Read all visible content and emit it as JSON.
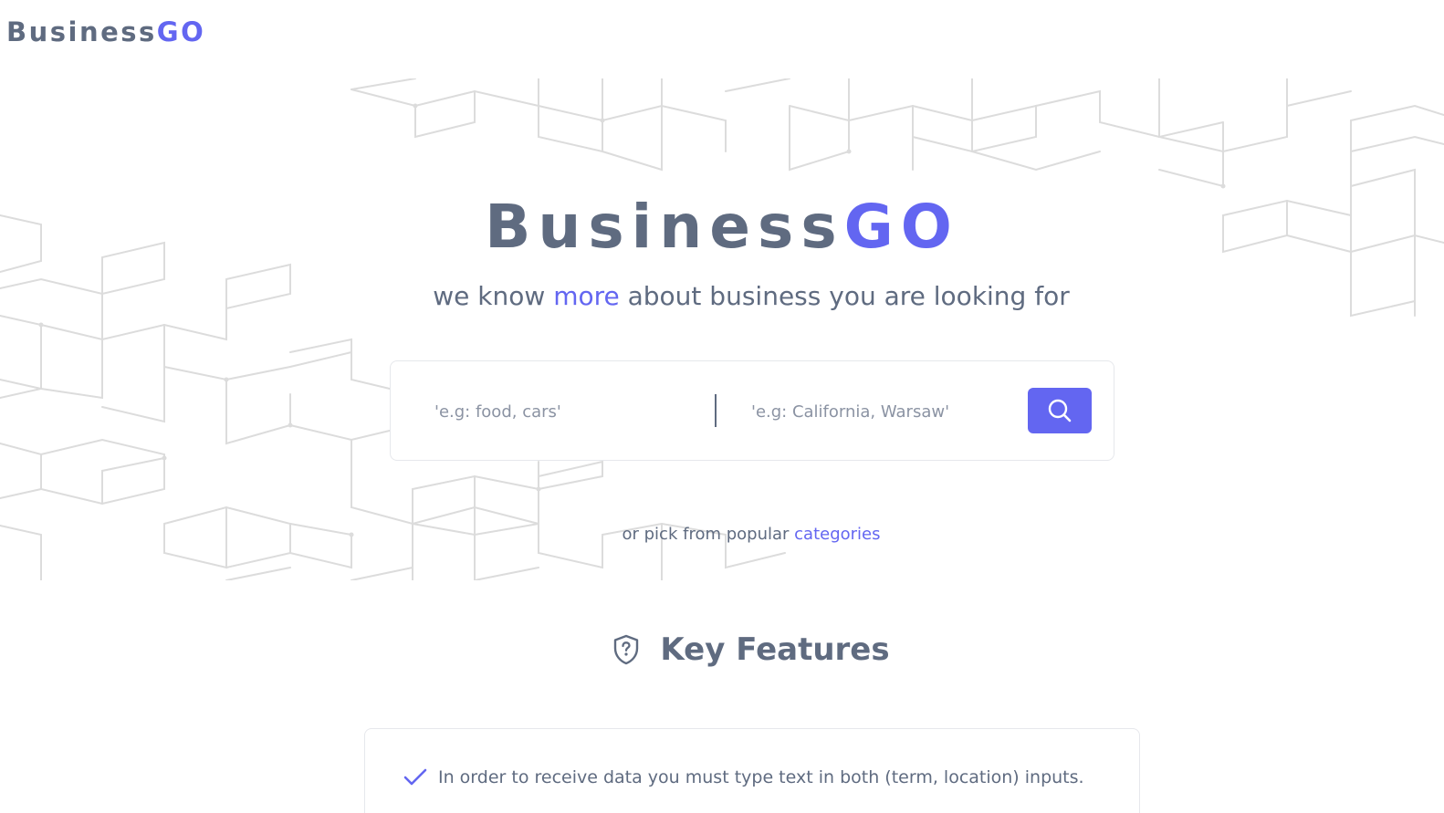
{
  "header": {
    "logo_main": "Business",
    "logo_accent": "GO"
  },
  "hero": {
    "title_main": "Business",
    "title_accent": "GO",
    "subtitle_before": "we know ",
    "subtitle_accent": "more",
    "subtitle_after": " about business you are looking for"
  },
  "search": {
    "term_placeholder": "'e.g: food, cars'",
    "location_placeholder": "'e.g: California, Warsaw'",
    "button_icon": "search-icon"
  },
  "categories": {
    "prefix": "or pick from popular ",
    "link_label": "categories"
  },
  "features": {
    "icon": "shield-question-icon",
    "title": "Key Features",
    "items": [
      {
        "icon": "check-icon",
        "text": "In order to receive data you must type text in both (term, location) inputs."
      }
    ]
  },
  "colors": {
    "accent": "#6366f1",
    "text": "#5f6b80",
    "pattern": "#dcdcdc"
  }
}
